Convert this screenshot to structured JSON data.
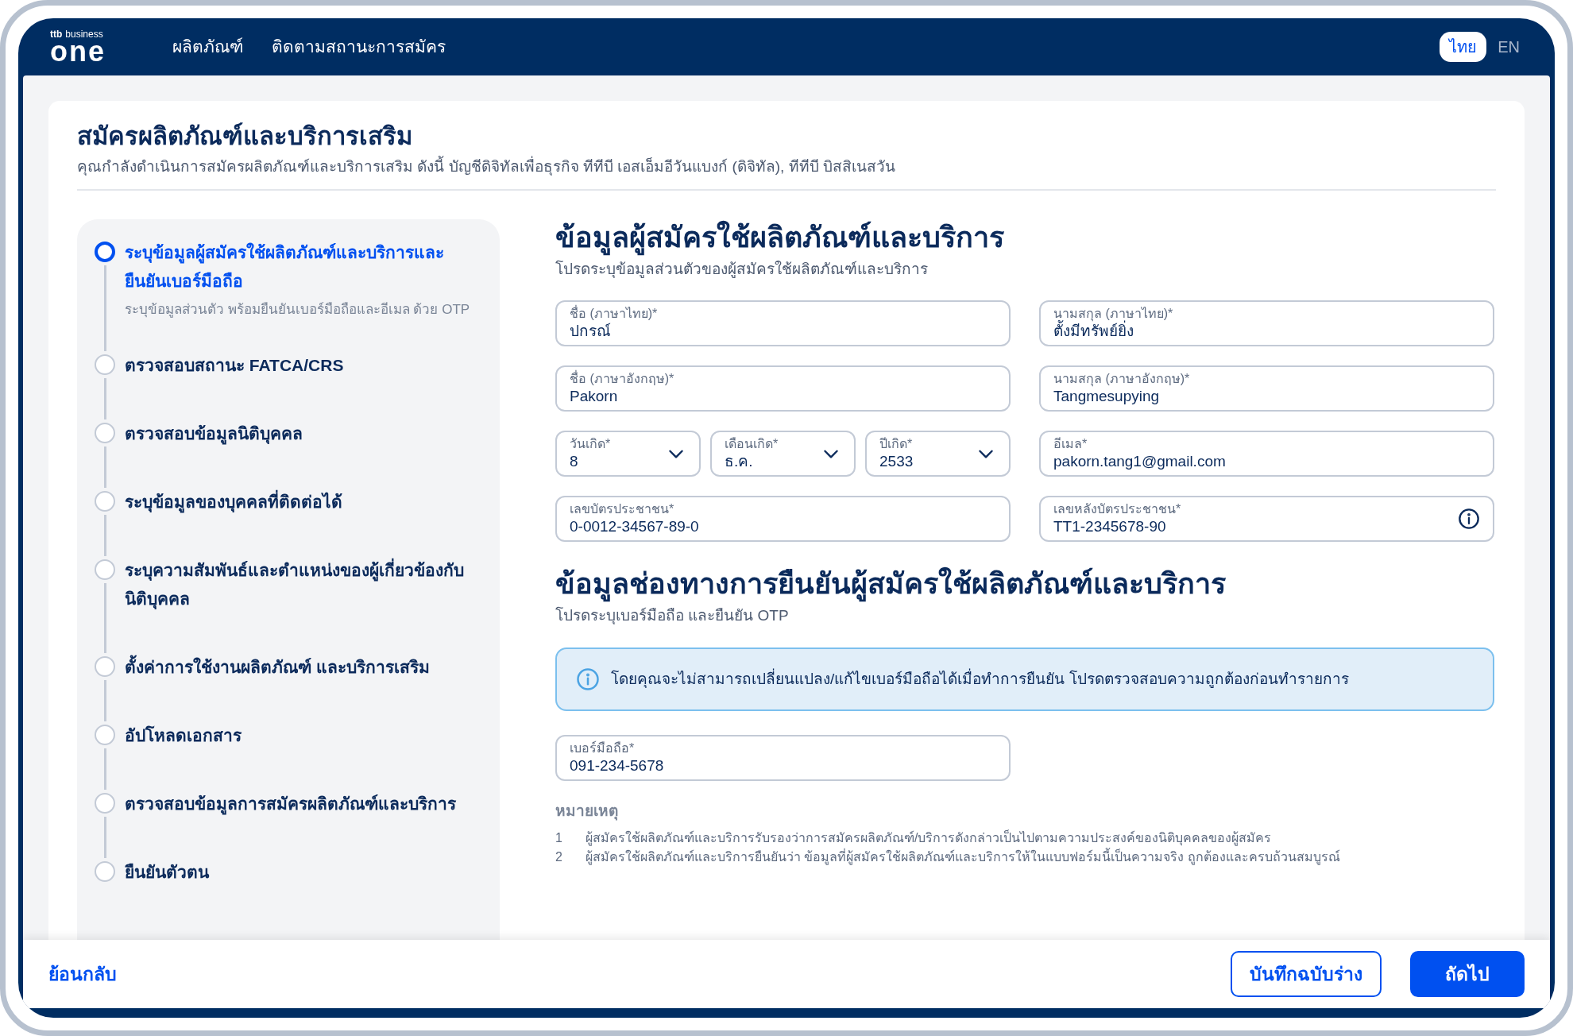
{
  "header": {
    "logo_brand": "ttb",
    "logo_suffix": "business",
    "logo_main": "one",
    "nav": [
      {
        "label": "ผลิตภัณฑ์"
      },
      {
        "label": "ติดตามสถานะการสมัคร"
      }
    ],
    "languages": [
      {
        "label": "ไทย",
        "selected": true
      },
      {
        "label": "EN",
        "selected": false
      }
    ]
  },
  "page": {
    "title": "สมัครผลิตภัณฑ์และบริการเสริม",
    "subtitle": "คุณกำลังดำเนินการสมัครผลิตภัณฑ์และบริการเสริม ดังนี้  บัญชีดิจิทัลเพื่อธุรกิจ ทีทีบี เอสเอ็มอีวันแบงก์ (ดิจิทัล),  ทีทีบี บิสสิเนสวัน"
  },
  "steps": [
    {
      "label": "ระบุข้อมูลผู้สมัครใช้ผลิตภัณฑ์และบริการและยืนยันเบอร์มือถือ",
      "description": "ระบุข้อมูลส่วนตัว พร้อมยืนยันเบอร์มือถือและอีเมล ด้วย OTP",
      "selected": true
    },
    {
      "label": "ตรวจสอบสถานะ FATCA/CRS",
      "selected": false
    },
    {
      "label": "ตรวจสอบข้อมูลนิติบุคคล",
      "selected": false
    },
    {
      "label": "ระบุข้อมูลของบุคคลที่ติดต่อได้",
      "selected": false
    },
    {
      "label": "ระบุความสัมพันธ์และตำแหน่งของผู้เกี่ยวข้องกับนิติบุคคล",
      "selected": false
    },
    {
      "label": "ตั้งค่าการใช้งานผลิตภัณฑ์ และบริการเสริม",
      "selected": false
    },
    {
      "label": "อัปโหลดเอกสาร",
      "selected": false
    },
    {
      "label": "ตรวจสอบข้อมูลการสมัครผลิตภัณฑ์และบริการ",
      "selected": false
    },
    {
      "label": "ยืนยันตัวตน",
      "selected": false
    }
  ],
  "applicant": {
    "title": "ข้อมูลผู้สมัครใช้ผลิตภัณฑ์และบริการ",
    "subtitle": "โปรดระบุข้อมูลส่วนตัวของผู้สมัครใช้ผลิตภัณฑ์และบริการ",
    "fields": [
      {
        "kind": "text",
        "label": "ชื่อ (ภาษาไทย)*",
        "value": "ปกรณ์"
      },
      {
        "kind": "text",
        "label": "นามสกุล (ภาษาไทย)*",
        "value": "ตั้งมีทรัพย์ยิ่ง"
      },
      {
        "kind": "text",
        "label": "ชื่อ (ภาษาอังกฤษ)*",
        "value": "Pakorn"
      },
      {
        "kind": "text",
        "label": "นามสกุล (ภาษาอังกฤษ)*",
        "value": "Tangmesupying"
      },
      {
        "kind": "select_group",
        "items": [
          {
            "label": "วันเกิด*",
            "value": "8"
          },
          {
            "label": "เดือนเกิด*",
            "value": "ธ.ค."
          },
          {
            "label": "ปีเกิด*",
            "value": "2533"
          }
        ]
      },
      {
        "kind": "text",
        "label": "อีเมล*",
        "value": "pakorn.tang1@gmail.com"
      },
      {
        "kind": "text",
        "label": "เลขบัตรประชาชน*",
        "value": "0-0012-34567-89-0"
      },
      {
        "kind": "text_info",
        "label": "เลขหลังบัตรประชาชน*",
        "value": "TT1-2345678-90"
      }
    ]
  },
  "verification": {
    "title": "ข้อมูลช่องทางการยืนยันผู้สมัครใช้ผลิตภัณฑ์และบริการ",
    "subtitle": "โปรดระบุเบอร์มือถือ และยืนยัน OTP",
    "alert": "โดยคุณจะไม่สามารถเปลี่ยนแปลง/แก้ไขเบอร์มือถือได้เมื่อทำการยืนยัน โปรดตรวจสอบความถูกต้องก่อนทำรายการ",
    "phone": {
      "label": "เบอร์มือถือ*",
      "value": "091-234-5678"
    }
  },
  "notes": {
    "title": "หมายเหตุ",
    "items": [
      {
        "number": "1",
        "text": "ผู้สมัครใช้ผลิตภัณฑ์และบริการรับรองว่าการสมัครผลิตภัณฑ์/บริการดังกล่าวเป็นไปตามความประสงค์ของนิติบุคคลของผู้สมัคร"
      },
      {
        "number": "2",
        "text": "ผู้สมัครใช้ผลิตภัณฑ์และบริการยืนยันว่า ข้อมูลที่ผู้สมัครใช้ผลิตภัณฑ์และบริการให้ในแบบฟอร์มนี้เป็นความจริง ถูกต้องและครบถ้วนสมบูรณ์"
      }
    ]
  },
  "footer": {
    "back": "ย้อนกลับ",
    "save_draft": "บันทึกฉบับร่าง",
    "next": "ถัดไป"
  }
}
